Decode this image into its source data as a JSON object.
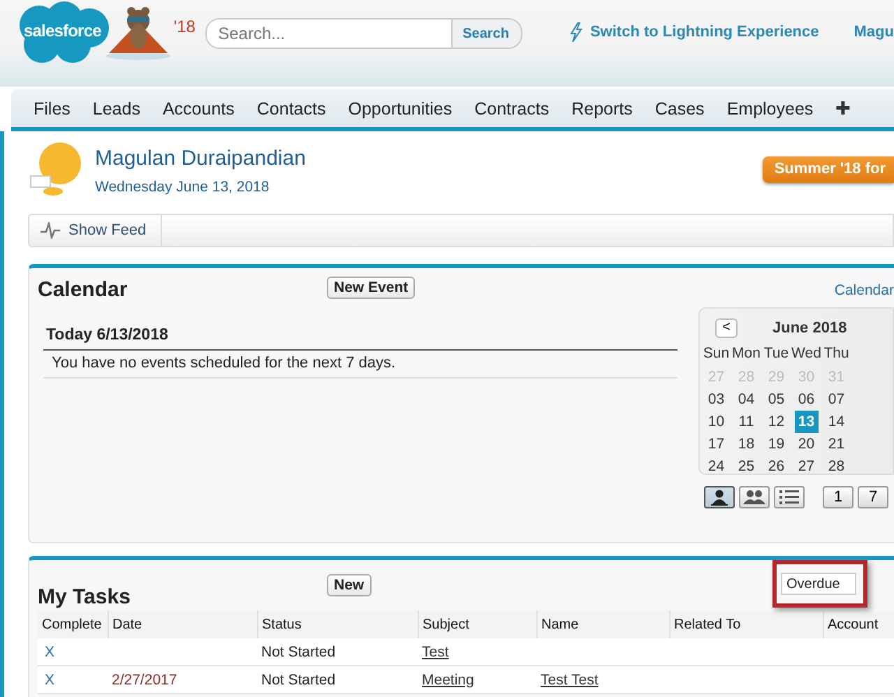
{
  "header": {
    "logo": "salesforce",
    "mascot_year": "'18",
    "search": {
      "placeholder": "Search...",
      "button": "Search"
    },
    "lightning_link": "Switch to Lightning Experience",
    "user_link": "Magu"
  },
  "nav": {
    "items": [
      "Files",
      "Leads",
      "Accounts",
      "Contacts",
      "Opportunities",
      "Contracts",
      "Reports",
      "Cases",
      "Employees"
    ],
    "more": "✚"
  },
  "profile": {
    "name": "Magulan Duraipandian",
    "date": "Wednesday June 13, 2018",
    "promo_button": "Summer '18 for"
  },
  "feed_button": "Show Feed",
  "calendar": {
    "title": "Calendar",
    "new_button": "New Event",
    "link": "Calendar",
    "today_heading": "Today 6/13/2018",
    "message": "You have no events scheduled for the next 7 days.",
    "mini": {
      "prev": "<",
      "month": "June 2018",
      "weekdays": [
        "Sun",
        "Mon",
        "Tue",
        "Wed",
        "Thu"
      ],
      "weeks": [
        [
          {
            "day": "27",
            "muted": true,
            "selected": false
          },
          {
            "day": "28",
            "muted": true,
            "selected": false
          },
          {
            "day": "29",
            "muted": true,
            "selected": false
          },
          {
            "day": "30",
            "muted": true,
            "selected": false
          },
          {
            "day": "31",
            "muted": true,
            "selected": false
          }
        ],
        [
          {
            "day": "03",
            "muted": false,
            "selected": false
          },
          {
            "day": "04",
            "muted": false,
            "selected": false
          },
          {
            "day": "05",
            "muted": false,
            "selected": false
          },
          {
            "day": "06",
            "muted": false,
            "selected": false
          },
          {
            "day": "07",
            "muted": false,
            "selected": false
          }
        ],
        [
          {
            "day": "10",
            "muted": false,
            "selected": false
          },
          {
            "day": "11",
            "muted": false,
            "selected": false
          },
          {
            "day": "12",
            "muted": false,
            "selected": false
          },
          {
            "day": "13",
            "muted": false,
            "selected": true
          },
          {
            "day": "14",
            "muted": false,
            "selected": false
          }
        ],
        [
          {
            "day": "17",
            "muted": false,
            "selected": false
          },
          {
            "day": "18",
            "muted": false,
            "selected": false
          },
          {
            "day": "19",
            "muted": false,
            "selected": false
          },
          {
            "day": "20",
            "muted": false,
            "selected": false
          },
          {
            "day": "21",
            "muted": false,
            "selected": false
          }
        ],
        [
          {
            "day": "24",
            "muted": false,
            "selected": false
          },
          {
            "day": "25",
            "muted": false,
            "selected": false
          },
          {
            "day": "26",
            "muted": false,
            "selected": false
          },
          {
            "day": "27",
            "muted": false,
            "selected": false
          },
          {
            "day": "28",
            "muted": false,
            "selected": false
          }
        ]
      ]
    },
    "views": [
      {
        "kind": "person",
        "selected": true
      },
      {
        "kind": "people",
        "selected": false
      },
      {
        "kind": "list",
        "selected": false
      }
    ],
    "ranges": [
      "1",
      "7"
    ]
  },
  "tasks": {
    "title": "My Tasks",
    "new_button": "New",
    "filter": "Overdue",
    "columns": [
      "Complete",
      "Date",
      "Status",
      "Subject",
      "Name",
      "Related To",
      "Account"
    ],
    "rows": [
      {
        "complete": "X",
        "status": "Not Started",
        "subject": "Test"
      },
      {
        "complete": "X",
        "date": "2/27/2017",
        "status": "Not Started",
        "subject": "Meeting",
        "name": "Test Test"
      }
    ]
  }
}
